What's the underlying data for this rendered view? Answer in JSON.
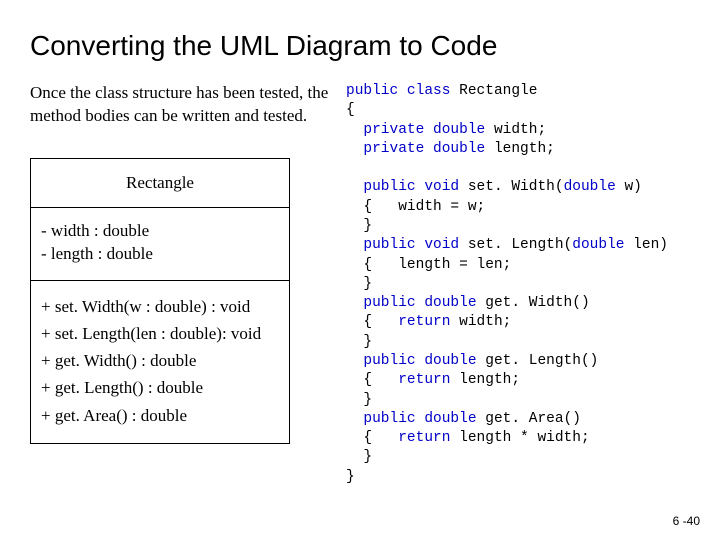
{
  "title": "Converting the UML Diagram to Code",
  "paragraph": "Once the class structure has been tested, the method bodies can be written and tested.",
  "uml": {
    "class_name": "Rectangle",
    "fields": [
      "- width : double",
      "- length : double"
    ],
    "methods": [
      "+ set. Width(w : double) : void",
      "+ set. Length(len : double): void",
      "+ get. Width() : double",
      "+ get. Length() : double",
      "+ get. Area() : double"
    ]
  },
  "code": {
    "kw_public": "public",
    "kw_class": "class",
    "kw_private": "private",
    "kw_double": "double",
    "kw_void": "void",
    "kw_return": "return",
    "cls": "Rectangle",
    "l1_open": "{",
    "f1": " width;",
    "f2": " length;",
    "m1_sig": " set. Width(",
    "m1_param": " w)",
    "m1_body": "  {   width = w;",
    "m1_close": "  }",
    "m2_sig": " set. Length(",
    "m2_param": " len)",
    "m2_body": "  {   length = len;",
    "m2_close": "  }",
    "m3_sig": " get. Width()",
    "m3_open": "  {   ",
    "m3_ret": " width;",
    "m3_close": "  }",
    "m4_sig": " get. Length()",
    "m4_open": "  {   ",
    "m4_ret": " length;",
    "m4_close": "  }",
    "m5_sig": " get. Area()",
    "m5_open": "  {   ",
    "m5_ret": " length * width;",
    "m5_close": "  }",
    "last_close": "}"
  },
  "page_number": "6 -40"
}
